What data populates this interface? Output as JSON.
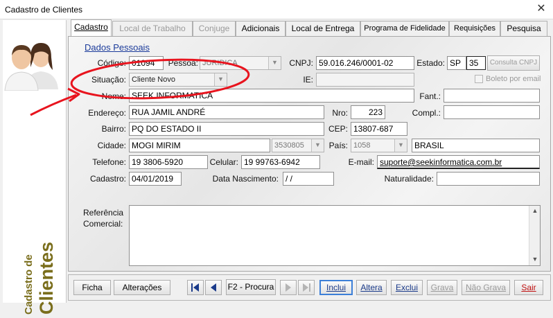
{
  "window": {
    "title": "Cadastro de Clientes",
    "close_glyph": "✕"
  },
  "sidebar": {
    "caption_small": "Cadastro de",
    "caption_large": "Clientes"
  },
  "tabs": [
    {
      "label": "Cadastro",
      "state": "active"
    },
    {
      "label": "Local de Trabalho",
      "state": "disabled"
    },
    {
      "label": "Conjuge",
      "state": "disabled"
    },
    {
      "label": "Adicionais",
      "state": "normal"
    },
    {
      "label": "Local de Entrega",
      "state": "normal"
    },
    {
      "label": "Programa de Fidelidade",
      "state": "normal"
    },
    {
      "label": "Requisições",
      "state": "normal"
    },
    {
      "label": "Pesquisa",
      "state": "normal"
    }
  ],
  "section": {
    "title": "Dados Pessoais"
  },
  "form": {
    "codigo": {
      "label": "Código:",
      "value": "01094"
    },
    "pessoa": {
      "label": "Pessoa:",
      "value": "JURIDICA"
    },
    "cnpj": {
      "label": "CNPJ:",
      "value": "59.016.246/0001-02"
    },
    "estado": {
      "label": "Estado:",
      "uf": "SP",
      "code": "35"
    },
    "consulta_cnpj": {
      "label": "Consulta CNPJ"
    },
    "situacao": {
      "label": "Situação:",
      "value": "Cliente Novo"
    },
    "ie": {
      "label": "IE:",
      "value": ""
    },
    "boleto": {
      "label": "Boleto por email",
      "checked": false
    },
    "nome": {
      "label": "Nome:",
      "value": "SEEK INFORMATICA"
    },
    "fant": {
      "label": "Fant.:",
      "value": ""
    },
    "endereco": {
      "label": "Endereço:",
      "value": "RUA JAMIL ANDRÉ"
    },
    "nro": {
      "label": "Nro:",
      "value": "223"
    },
    "compl": {
      "label": "Compl.:",
      "value": ""
    },
    "bairro": {
      "label": "Bairro:",
      "value": "PQ DO ESTADO II"
    },
    "cep": {
      "label": "CEP:",
      "value": "13807-687"
    },
    "cidade": {
      "label": "Cidade:",
      "value": "MOGI MIRIM",
      "code": "3530805"
    },
    "pais": {
      "label": "País:",
      "code": "1058",
      "name": "BRASIL"
    },
    "telefone": {
      "label": "Telefone:",
      "value": "19 3806-5920"
    },
    "celular": {
      "label": "Celular:",
      "value": "19 99763-6942"
    },
    "email": {
      "label": "E-mail:",
      "value": "suporte@seekinformatica.com.br"
    },
    "cadastro": {
      "label": "Cadastro:",
      "value": "04/01/2019"
    },
    "nascimento": {
      "label": "Data Nascimento:",
      "value": " /  /"
    },
    "naturalidade": {
      "label": "Naturalidade:",
      "value": ""
    },
    "referencia": {
      "label_line1": "Referência",
      "label_line2": "Comercial:",
      "value": ""
    }
  },
  "toolbar": {
    "ficha": "Ficha",
    "alteracoes": "Alterações",
    "procura": "F2 - Procura",
    "inclui": "Inclui",
    "altera": "Altera",
    "exclui": "Exclui",
    "grava": "Grava",
    "nao_grava": "Não Grava",
    "sair": "Sair"
  },
  "colors": {
    "sidebar_caption": "#7a6e1c",
    "annotation": "#e8141e",
    "link": "#1a3a9a",
    "focus": "#3c7fd8"
  },
  "icons": [
    "users-icon",
    "first-record-icon",
    "prev-record-icon",
    "next-record-icon",
    "last-record-icon",
    "chevron-down-icon",
    "close-icon"
  ]
}
